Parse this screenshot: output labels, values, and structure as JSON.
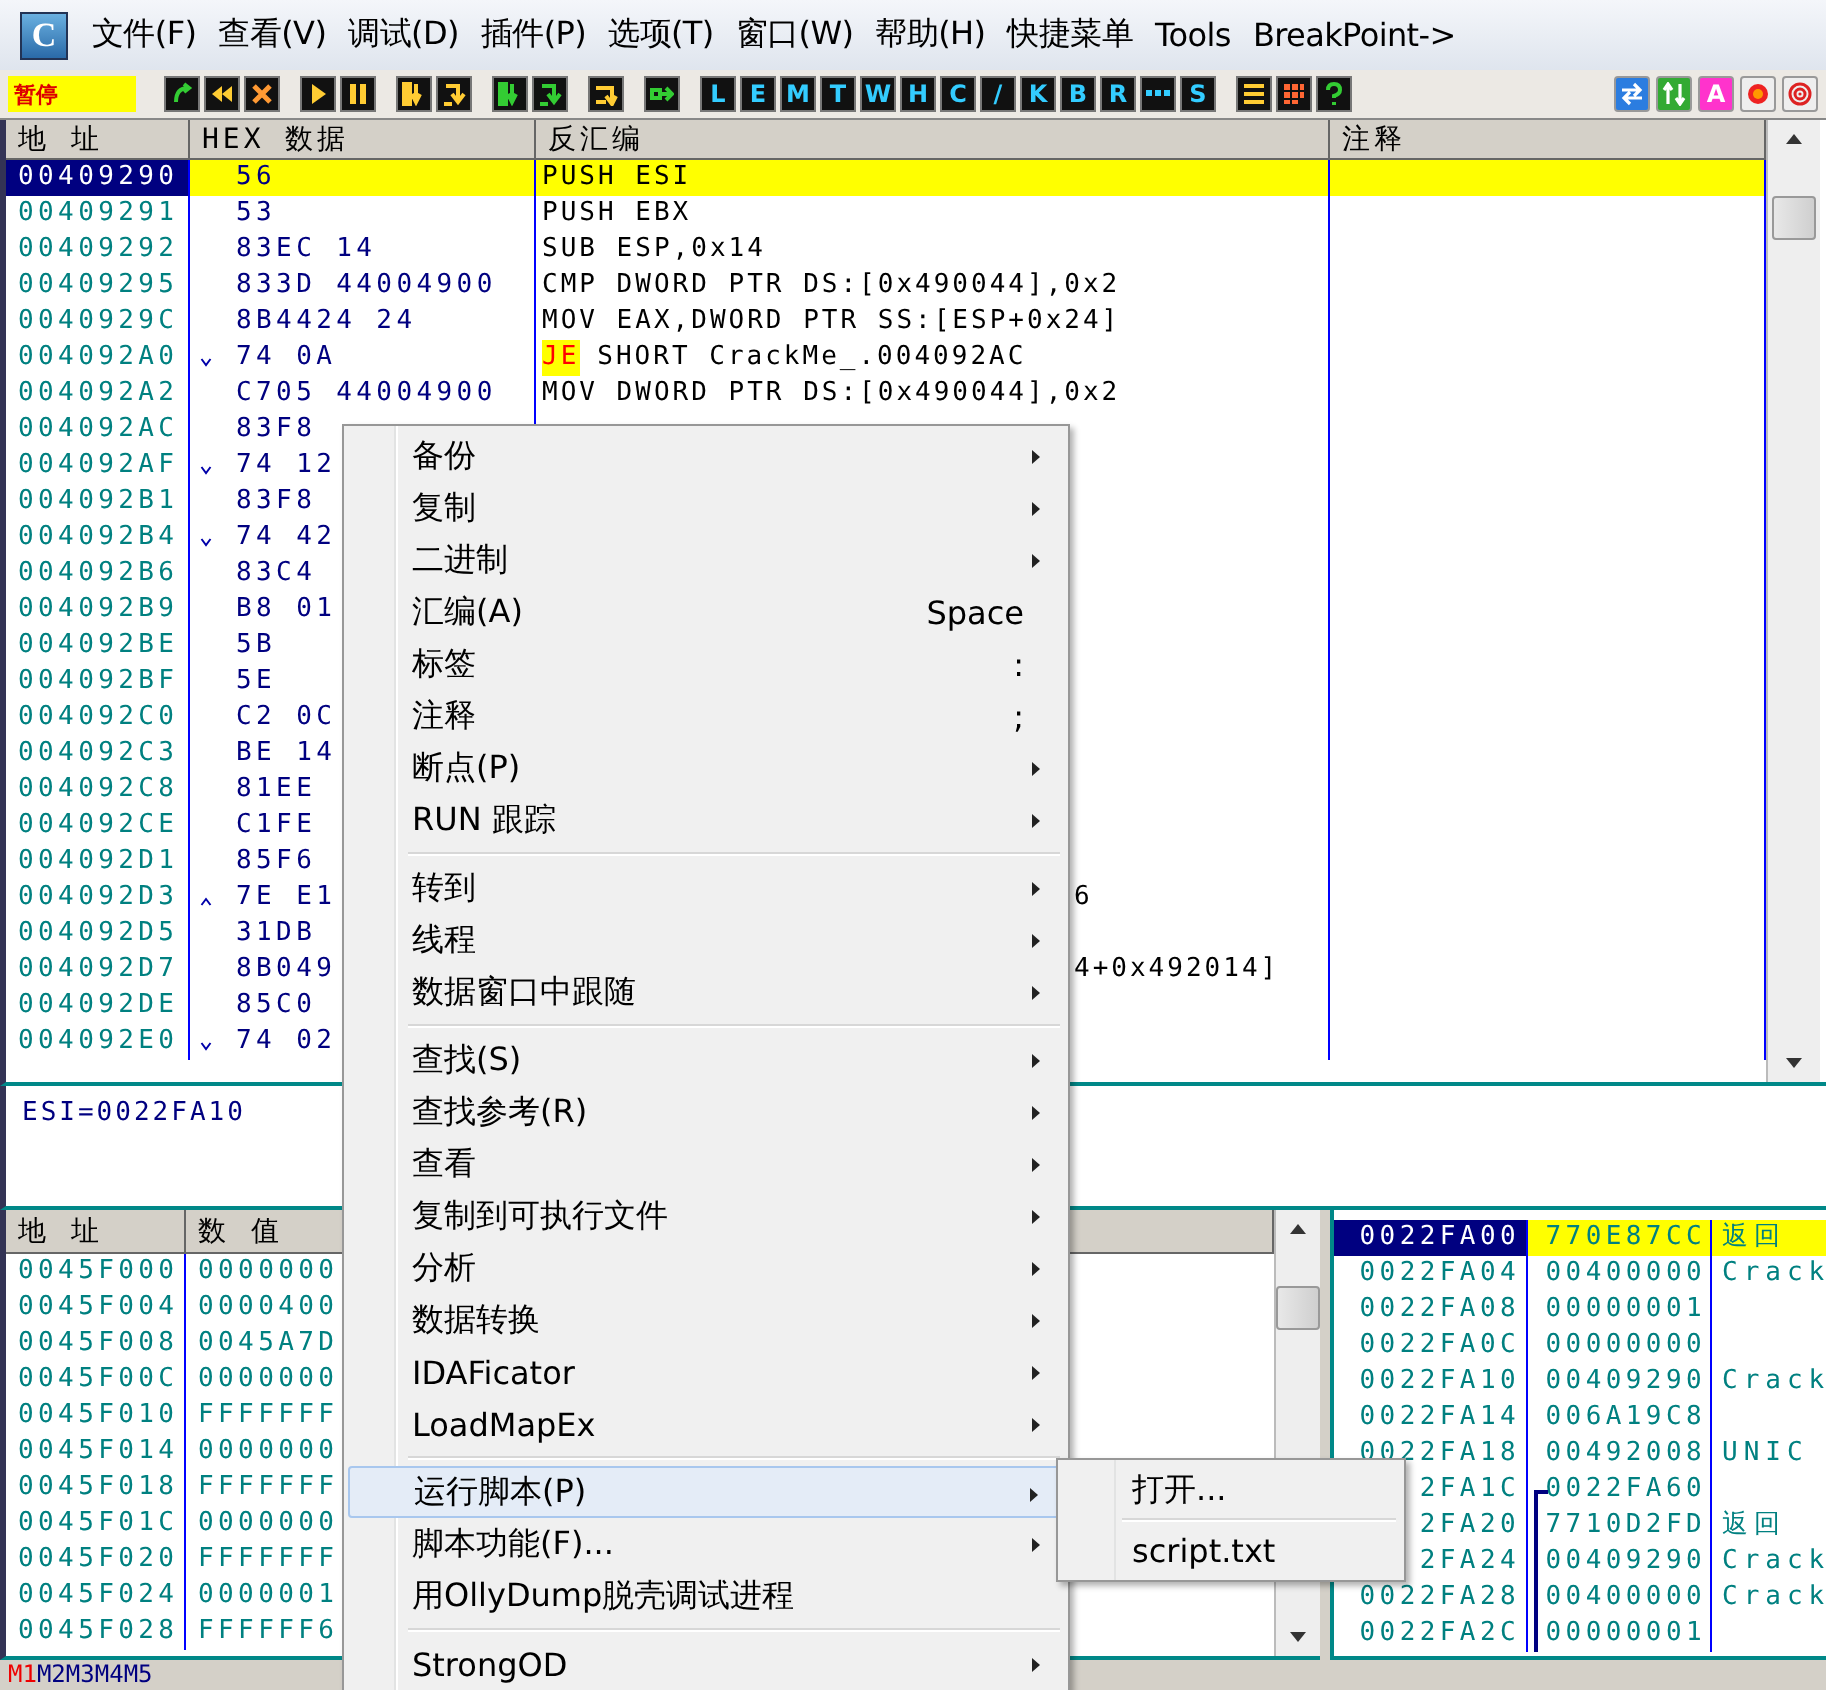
{
  "menubar": {
    "logo": "C",
    "items": [
      "文件(F)",
      "查看(V)",
      "调试(D)",
      "插件(P)",
      "选项(T)",
      "窗口(W)",
      "帮助(H)",
      "快捷菜单",
      "Tools",
      "BreakPoint->"
    ]
  },
  "toolbar": {
    "status": "暂停",
    "letter_buttons": [
      {
        "kind": "letter",
        "label": "L"
      },
      {
        "kind": "letter",
        "label": "E"
      },
      {
        "kind": "letter",
        "label": "M"
      },
      {
        "kind": "letter",
        "label": "T"
      },
      {
        "kind": "letter",
        "label": "W"
      },
      {
        "kind": "letter",
        "label": "H"
      },
      {
        "kind": "letter",
        "label": "C"
      },
      {
        "kind": "letter",
        "label": "/"
      },
      {
        "kind": "letter",
        "label": "K"
      },
      {
        "kind": "letter",
        "label": "B"
      },
      {
        "kind": "letter",
        "label": "R"
      },
      {
        "kind": "dots"
      },
      {
        "kind": "letter",
        "label": "S"
      }
    ],
    "font_button": "A"
  },
  "disassembly": {
    "columns": [
      "地 址",
      "HEX 数据",
      "反汇编",
      "注释"
    ],
    "rows": [
      {
        "address": "00409290",
        "hex": "56",
        "jump_down": false,
        "jump_up": false,
        "code": "PUSH ESI",
        "selected": true
      },
      {
        "address": "00409291",
        "hex": "53",
        "jump_down": false,
        "jump_up": false,
        "code": "PUSH EBX",
        "selected": false
      },
      {
        "address": "00409292",
        "hex": "83EC 14",
        "jump_down": false,
        "jump_up": false,
        "code": "SUB ESP,0x14",
        "selected": false
      },
      {
        "address": "00409295",
        "hex": "833D 44004900",
        "jump_down": false,
        "jump_up": false,
        "code": "CMP DWORD PTR DS:[0x490044],0x2",
        "selected": false
      },
      {
        "address": "0040929C",
        "hex": "8B4424 24",
        "jump_down": false,
        "jump_up": false,
        "code": "MOV EAX,DWORD PTR SS:[ESP+0x24]",
        "selected": false
      },
      {
        "address": "004092A0",
        "hex": "74 0A",
        "jump_down": true,
        "jump_up": false,
        "highlight": "JE",
        "code": "SHORT CrackMe_.004092AC",
        "selected": false
      },
      {
        "address": "004092A2",
        "hex": "C705 44004900",
        "jump_down": false,
        "jump_up": false,
        "code": "MOV DWORD PTR DS:[0x490044],0x2",
        "selected": false
      },
      {
        "address": "004092AC",
        "hex": "83F8",
        "jump_down": false,
        "jump_up": false,
        "selected": false
      },
      {
        "address": "004092AF",
        "hex": "74 12",
        "jump_down": true,
        "jump_up": false,
        "selected": false
      },
      {
        "address": "004092B1",
        "hex": "83F8",
        "jump_down": false,
        "jump_up": false,
        "selected": false
      },
      {
        "address": "004092B4",
        "hex": "74 42",
        "jump_down": true,
        "jump_up": false,
        "selected": false
      },
      {
        "address": "004092B6",
        "hex": "83C4",
        "jump_down": false,
        "jump_up": false,
        "selected": false
      },
      {
        "address": "004092B9",
        "hex": "B8 01",
        "jump_down": false,
        "jump_up": false,
        "selected": false
      },
      {
        "address": "004092BE",
        "hex": "5B",
        "jump_down": false,
        "jump_up": false,
        "selected": false
      },
      {
        "address": "004092BF",
        "hex": "5E",
        "jump_down": false,
        "jump_up": false,
        "selected": false
      },
      {
        "address": "004092C0",
        "hex": "C2 0C",
        "jump_down": false,
        "jump_up": false,
        "selected": false
      },
      {
        "address": "004092C3",
        "hex": "BE 14",
        "jump_down": false,
        "jump_up": false,
        "selected": false
      },
      {
        "address": "004092C8",
        "hex": "81EE",
        "jump_down": false,
        "jump_up": false,
        "selected": false
      },
      {
        "address": "004092CE",
        "hex": "C1FE",
        "jump_down": false,
        "jump_up": false,
        "selected": false
      },
      {
        "address": "004092D1",
        "hex": "85F6",
        "jump_down": false,
        "jump_up": false,
        "selected": false
      },
      {
        "address": "004092D3",
        "hex": "7E E1",
        "jump_down": false,
        "jump_up": true,
        "code_tail": "6",
        "selected": false
      },
      {
        "address": "004092D5",
        "hex": "31DB",
        "jump_down": false,
        "jump_up": false,
        "selected": false
      },
      {
        "address": "004092D7",
        "hex": "8B049",
        "jump_down": false,
        "jump_up": false,
        "code_tail": "4+0x492014]",
        "selected": false
      },
      {
        "address": "004092DE",
        "hex": "85C0",
        "jump_down": false,
        "jump_up": false,
        "selected": false
      },
      {
        "address": "004092E0",
        "hex": "74 02",
        "jump_down": true,
        "jump_up": false,
        "selected": false
      }
    ]
  },
  "info": "ESI=0022FA10",
  "dump": {
    "columns": [
      "地 址",
      "数 值"
    ],
    "rows": [
      {
        "address": "0045F000",
        "value": "0000000"
      },
      {
        "address": "0045F004",
        "value": "0000400"
      },
      {
        "address": "0045F008",
        "value": "0045A7D"
      },
      {
        "address": "0045F00C",
        "value": "0000000"
      },
      {
        "address": "0045F010",
        "value": "FFFFFFF"
      },
      {
        "address": "0045F014",
        "value": "0000000"
      },
      {
        "address": "0045F018",
        "value": "FFFFFFF"
      },
      {
        "address": "0045F01C",
        "value": "0000000"
      },
      {
        "address": "0045F020",
        "value": "FFFFFFF"
      },
      {
        "address": "0045F024",
        "value": "0000001"
      },
      {
        "address": "0045F028",
        "value": "FFFFFF6"
      }
    ]
  },
  "stack": {
    "rows": [
      {
        "address": "0022FA00",
        "value": "770E87CC",
        "comment": "返回",
        "selected": true,
        "frame_start": false,
        "in_frame": false
      },
      {
        "address": "0022FA04",
        "value": "00400000",
        "comment": "Crack",
        "selected": false,
        "frame_start": false,
        "in_frame": false
      },
      {
        "address": "0022FA08",
        "value": "00000001",
        "selected": false,
        "frame_start": false,
        "in_frame": false
      },
      {
        "address": "0022FA0C",
        "value": "00000000",
        "selected": false,
        "frame_start": false,
        "in_frame": false
      },
      {
        "address": "0022FA10",
        "value": "00409290",
        "comment": "Crack",
        "selected": false,
        "frame_start": false,
        "in_frame": false
      },
      {
        "address": "0022FA14",
        "value": "006A19C8",
        "selected": false,
        "frame_start": false,
        "in_frame": false
      },
      {
        "address": "0022FA18",
        "value": "00492008",
        "comment": "UNIC",
        "selected": false,
        "frame_start": false,
        "in_frame": false
      },
      {
        "address": "2FA1C",
        "value": "0022FA60",
        "selected": false,
        "frame_start": true,
        "in_frame": true
      },
      {
        "address": "2FA20",
        "value": "7710D2FD",
        "comment": "返回",
        "selected": false,
        "frame_start": false,
        "in_frame": true
      },
      {
        "address": "2FA24",
        "value": "00409290",
        "comment": "Crack",
        "selected": false,
        "frame_start": false,
        "in_frame": true
      },
      {
        "address": "0022FA28",
        "value": "00400000",
        "comment": "Crack",
        "selected": false,
        "frame_start": false,
        "in_frame": true
      },
      {
        "address": "0022FA2C",
        "value": "00000001",
        "selected": false,
        "frame_start": false,
        "in_frame": true
      }
    ]
  },
  "status_tabs": [
    {
      "label": "M1",
      "selected": true
    },
    {
      "label": "M2",
      "selected": false
    },
    {
      "label": "M3",
      "selected": false
    },
    {
      "label": "M4",
      "selected": false
    },
    {
      "label": "M5",
      "selected": false
    }
  ],
  "context_menu": {
    "groups": [
      [
        {
          "label": "备份",
          "submenu": true,
          "selected": false
        },
        {
          "label": "复制",
          "submenu": true,
          "selected": false
        },
        {
          "label": "二进制",
          "submenu": true,
          "selected": false
        },
        {
          "label": "汇编(A)",
          "shortcut": "Space",
          "submenu": false,
          "selected": false
        },
        {
          "label": "标签",
          "shortcut": ":",
          "submenu": false,
          "selected": false
        },
        {
          "label": "注释",
          "shortcut": ";",
          "submenu": false,
          "selected": false
        },
        {
          "label": "断点(P)",
          "submenu": true,
          "selected": false
        },
        {
          "label": "RUN 跟踪",
          "submenu": true,
          "selected": false
        }
      ],
      [
        {
          "label": "转到",
          "submenu": true,
          "selected": false
        },
        {
          "label": "线程",
          "submenu": true,
          "selected": false
        },
        {
          "label": "数据窗口中跟随",
          "submenu": true,
          "selected": false
        }
      ],
      [
        {
          "label": "查找(S)",
          "submenu": true,
          "selected": false
        },
        {
          "label": "查找参考(R)",
          "submenu": true,
          "selected": false
        },
        {
          "label": "查看",
          "submenu": true,
          "selected": false
        },
        {
          "label": "复制到可执行文件",
          "submenu": true,
          "selected": false
        },
        {
          "label": "分析",
          "submenu": true,
          "selected": false
        },
        {
          "label": "数据转换",
          "submenu": true,
          "selected": false
        },
        {
          "label": "IDAFicator",
          "submenu": true,
          "selected": false
        },
        {
          "label": "LoadMapEx",
          "submenu": true,
          "selected": false
        }
      ],
      [
        {
          "label": "运行脚本(P)",
          "submenu": true,
          "selected": true
        },
        {
          "label": "脚本功能(F)...",
          "submenu": true,
          "selected": false
        },
        {
          "label": "用OllyDump脱壳调试进程",
          "submenu": false,
          "selected": false
        }
      ],
      [
        {
          "label": "StrongOD",
          "submenu": true,
          "selected": false
        }
      ]
    ]
  },
  "submenu": {
    "groups": [
      [
        {
          "label": "打开..."
        }
      ],
      [
        {
          "label": "script.txt"
        }
      ]
    ]
  }
}
